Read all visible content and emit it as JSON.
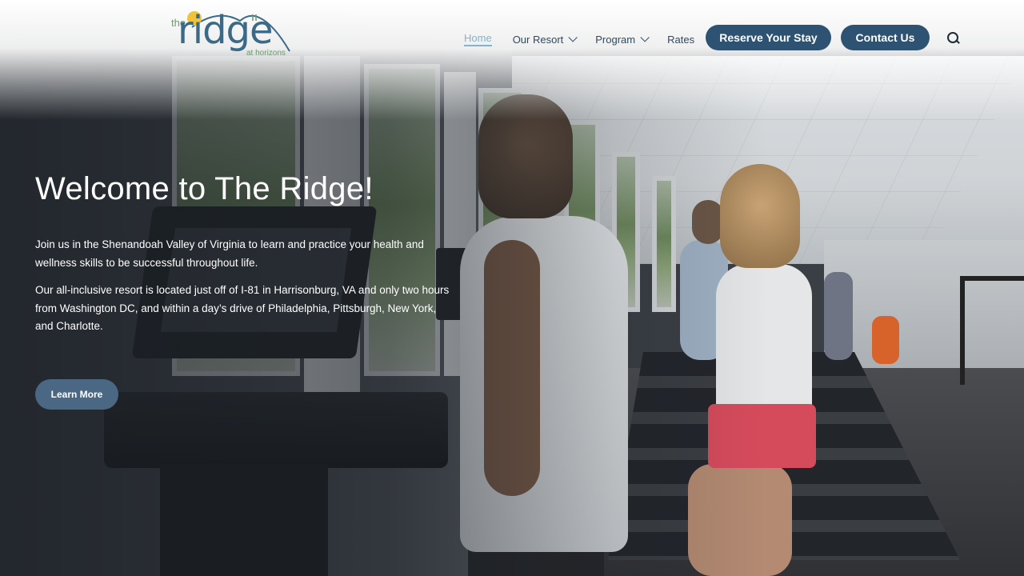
{
  "logo": {
    "the": "the",
    "word": "ridge",
    "tagline": "at horizons"
  },
  "nav": {
    "items": [
      {
        "label": "Home",
        "active": true,
        "dropdown": false
      },
      {
        "label": "Our Resort",
        "active": false,
        "dropdown": true
      },
      {
        "label": "Program",
        "active": false,
        "dropdown": true
      },
      {
        "label": "Rates",
        "active": false,
        "dropdown": false
      }
    ],
    "reserve_label": "Reserve Your Stay",
    "contact_label": "Contact Us",
    "search_icon": "search-icon"
  },
  "hero": {
    "title": "Welcome to The Ridge!",
    "paragraph1": "Join us in the Shenandoah Valley of Virginia to learn and practice your health and wellness skills to be successful throughout life.",
    "paragraph2": "Our all-inclusive resort is located just off of I-81 in Harrisonburg, VA and only two hours from Washington DC, and within a day’s drive of Philadelphia, Pittsburgh, New York, and Charlotte.",
    "button_label": "Learn More"
  },
  "colors": {
    "brand": "#2e5272",
    "nav_active": "#7fb4d2",
    "learn_more": "#4a6784"
  }
}
